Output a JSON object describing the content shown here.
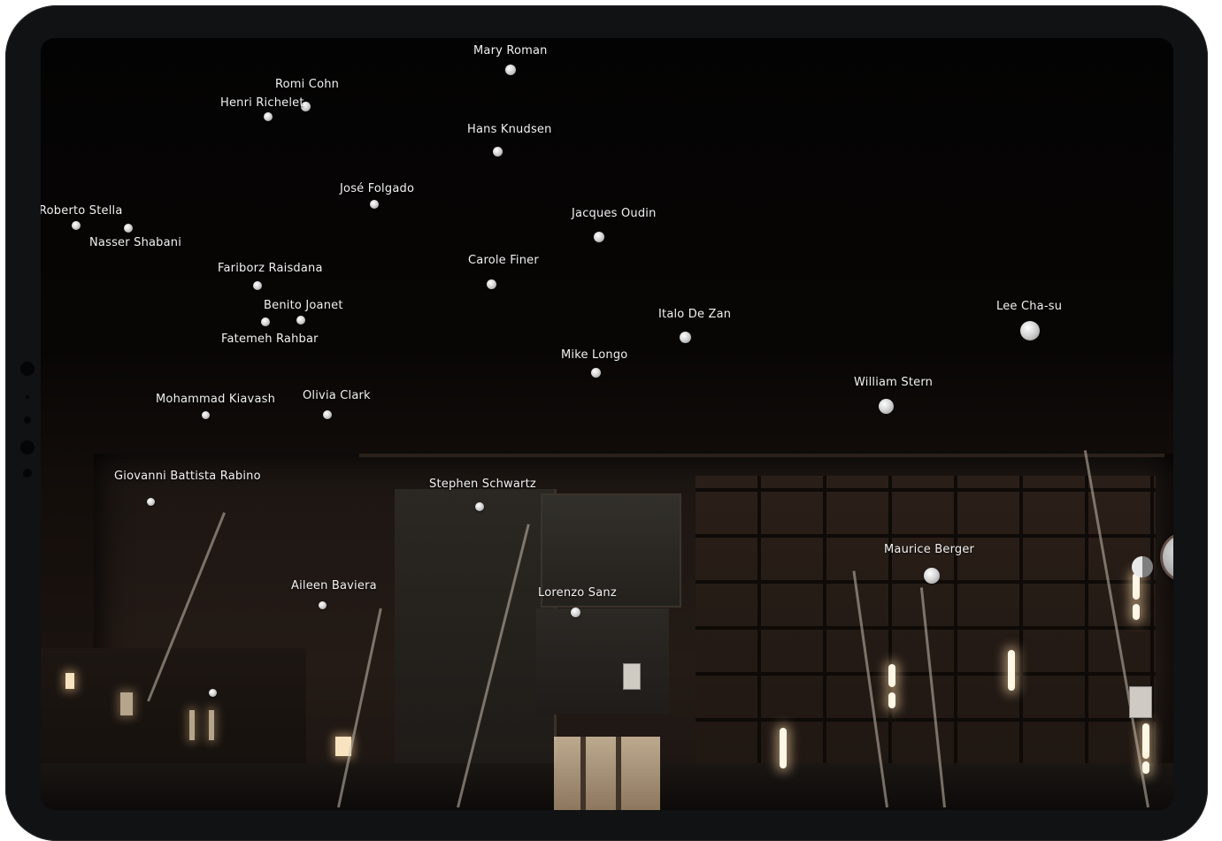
{
  "contacts": [
    {
      "name": "Mary Roman"
    },
    {
      "name": "Romi Cohn"
    },
    {
      "name": "Henri Richelet"
    },
    {
      "name": "Hans Knudsen"
    },
    {
      "name": "José Folgado"
    },
    {
      "name": "Roberto Stella"
    },
    {
      "name": "Nasser Shabani"
    },
    {
      "name": "Jacques Oudin"
    },
    {
      "name": "Fariborz Raisdana"
    },
    {
      "name": "Carole Finer"
    },
    {
      "name": "Benito Joanet"
    },
    {
      "name": "Fatemeh Rahbar"
    },
    {
      "name": "Italo De Zan"
    },
    {
      "name": "Lee Cha-su"
    },
    {
      "name": "Mike Longo"
    },
    {
      "name": "William Stern"
    },
    {
      "name": "Mohammad Kiavash"
    },
    {
      "name": "Olivia Clark"
    },
    {
      "name": "Giovanni Battista Rabino"
    },
    {
      "name": "Stephen Schwartz"
    },
    {
      "name": "Maurice Berger"
    },
    {
      "name": "Aileen Baviera"
    },
    {
      "name": "Lorenzo Sanz"
    }
  ]
}
